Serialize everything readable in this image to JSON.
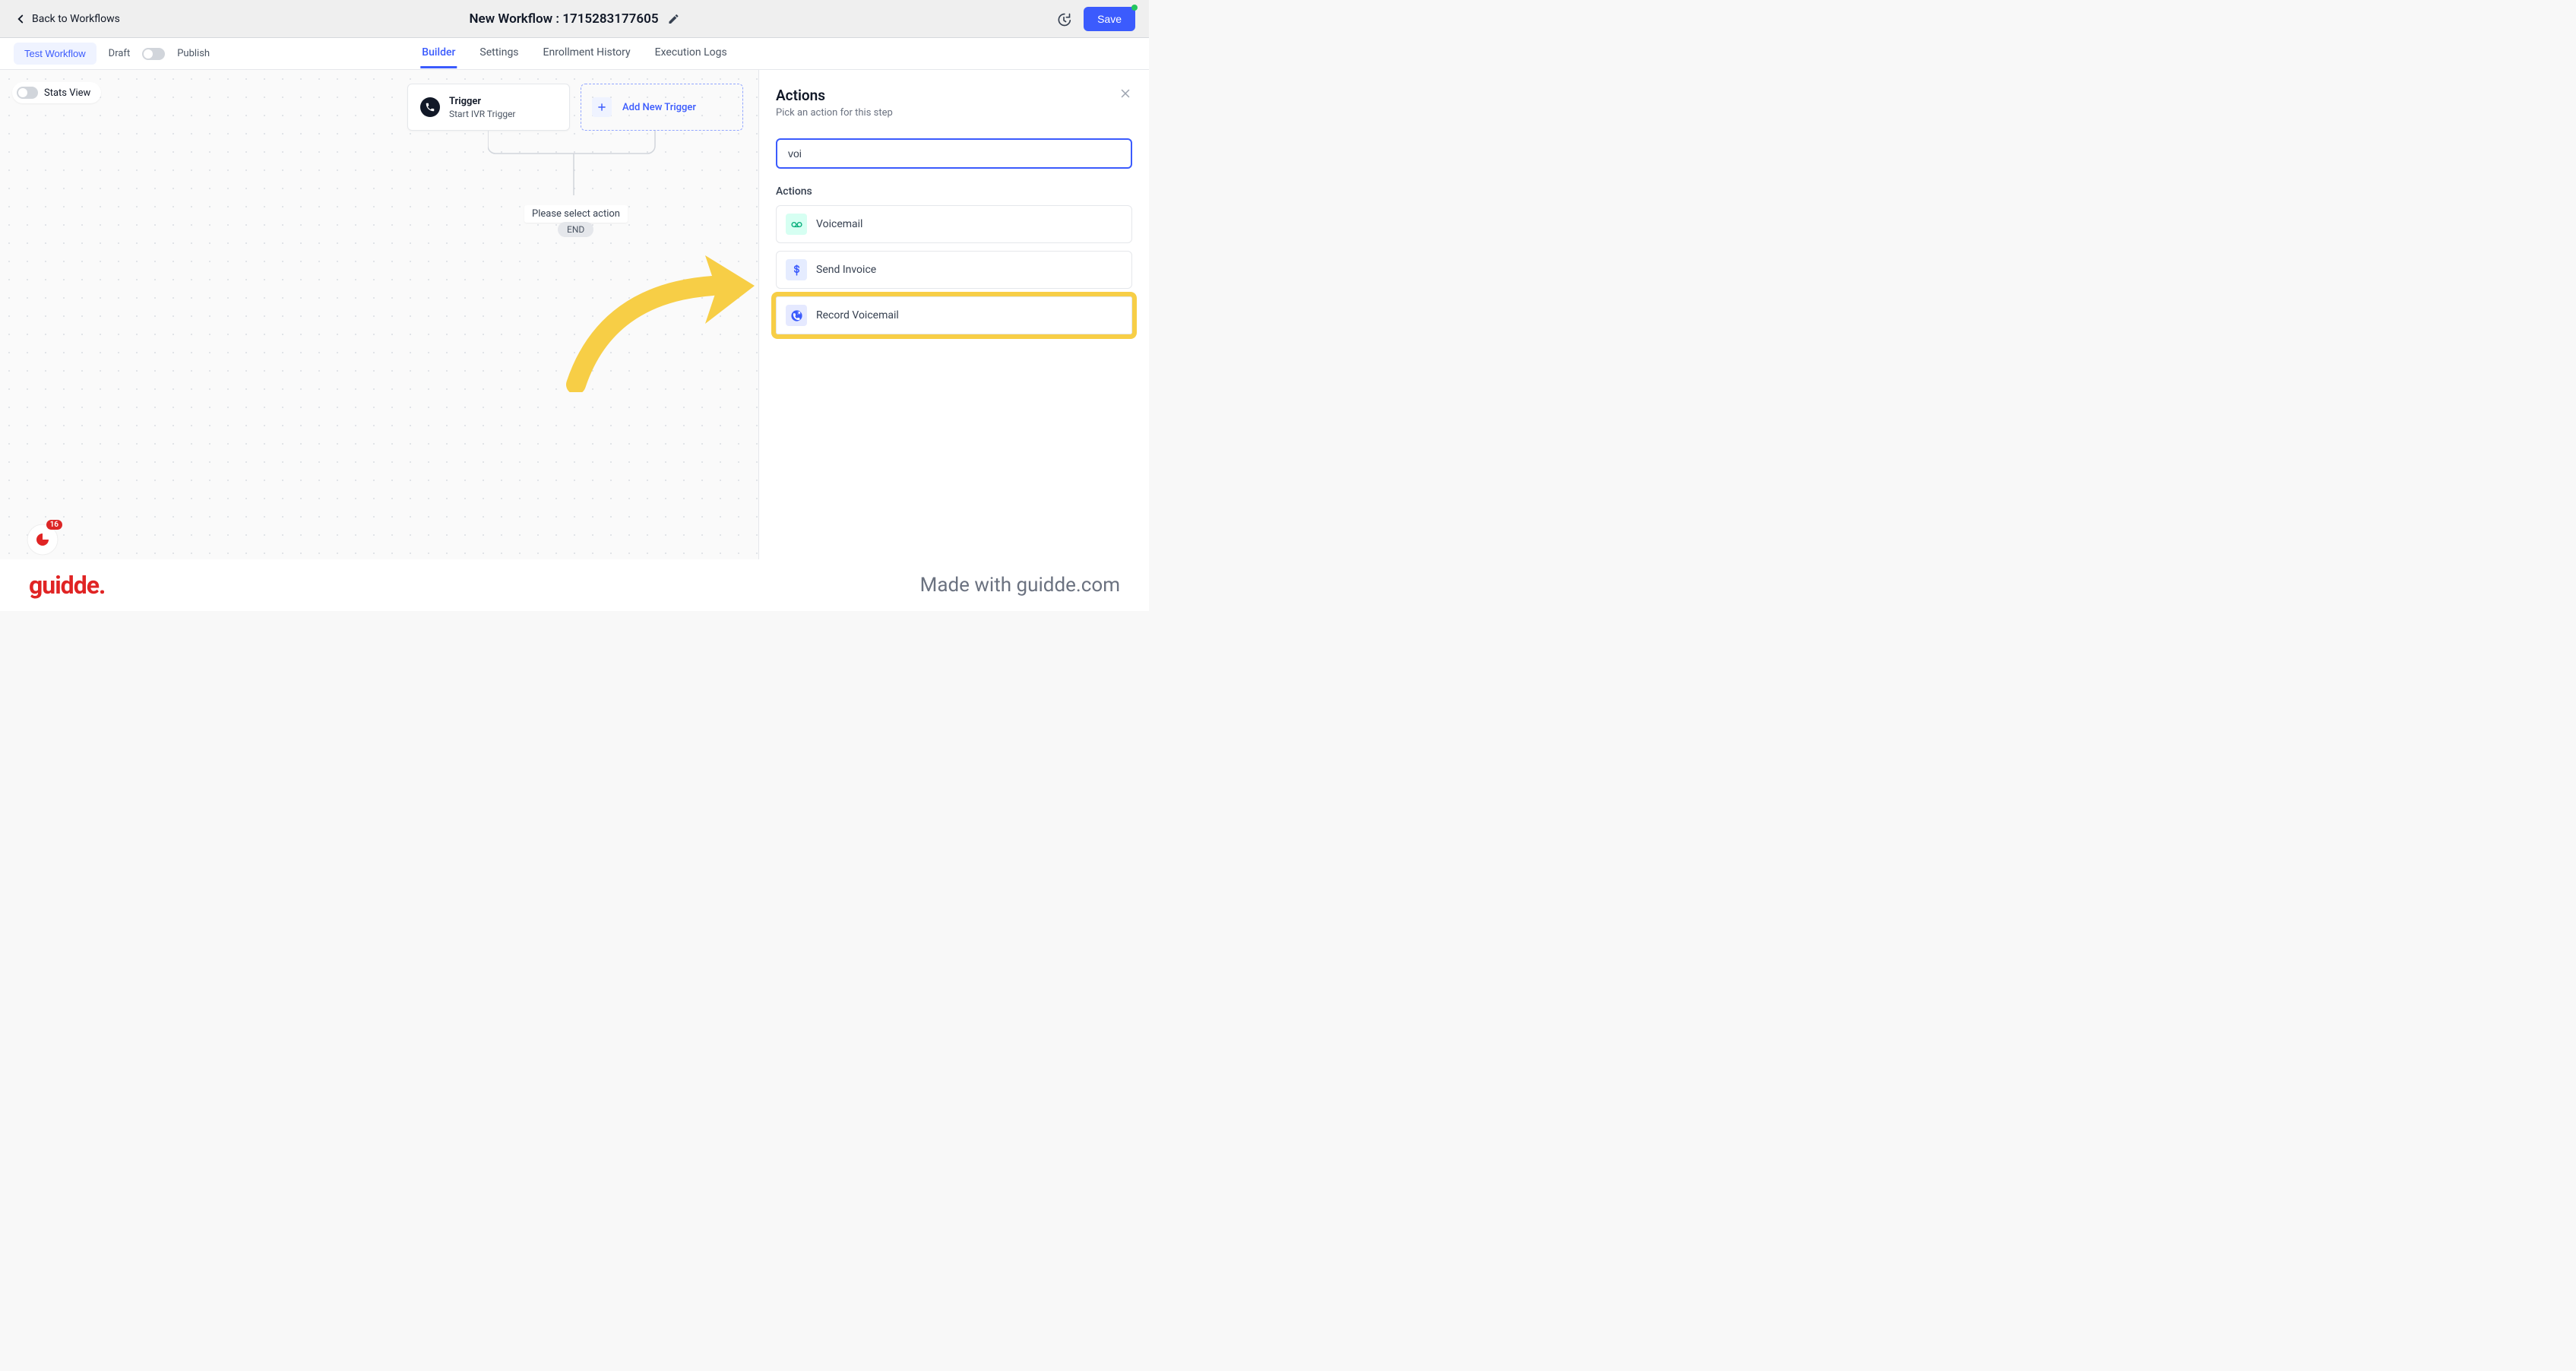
{
  "header": {
    "back_label": "Back to Workflows",
    "title": "New Workflow : 1715283177605",
    "save_label": "Save"
  },
  "nav": {
    "tabs": [
      "Builder",
      "Settings",
      "Enrollment History",
      "Execution Logs"
    ],
    "test_label": "Test Workflow",
    "draft_label": "Draft",
    "publish_label": "Publish"
  },
  "canvas": {
    "stats_view_label": "Stats View",
    "trigger": {
      "title": "Trigger",
      "subtitle": "Start IVR Trigger"
    },
    "add_trigger_label": "Add New Trigger",
    "select_action_label": "Please select action",
    "end_label": "END"
  },
  "panel": {
    "title": "Actions",
    "subtitle": "Pick an action for this step",
    "search_value": "voi",
    "list_label": "Actions",
    "items": [
      {
        "icon": "voicemail",
        "label": "Voicemail"
      },
      {
        "icon": "dollar",
        "label": "Send Invoice"
      },
      {
        "icon": "phone-out",
        "label": "Record Voicemail"
      }
    ]
  },
  "widget": {
    "badge": "16"
  },
  "footer": {
    "logo": "guidde.",
    "made": "Made with guidde.com"
  }
}
